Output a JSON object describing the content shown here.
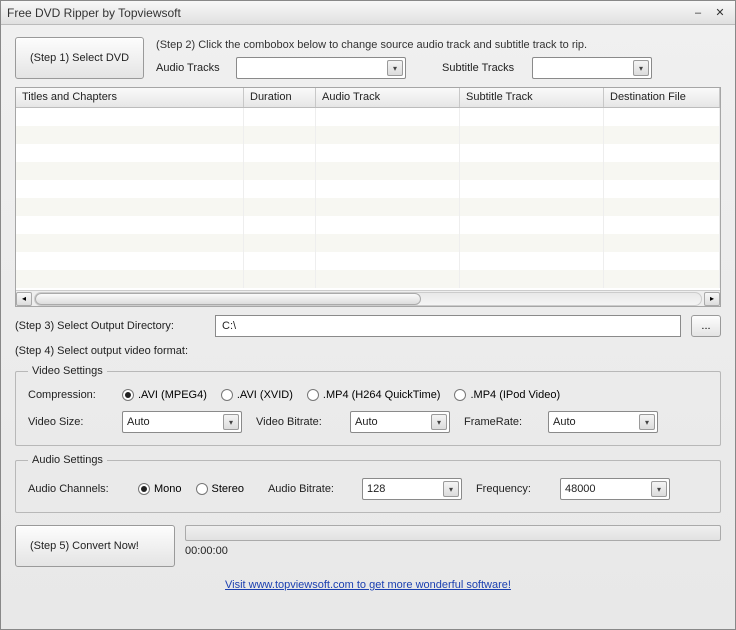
{
  "titlebar": {
    "title": "Free DVD Ripper by Topviewsoft"
  },
  "step1": {
    "button": "(Step 1) Select DVD"
  },
  "step2": {
    "instruction": "(Step 2) Click the combobox below to change source audio track and subtitle track to rip.",
    "audio_label": "Audio Tracks",
    "audio_value": "",
    "subtitle_label": "Subtitle Tracks",
    "subtitle_value": ""
  },
  "grid": {
    "headers": [
      "Titles and Chapters",
      "Duration",
      "Audio Track",
      "Subtitle Track",
      "Destination File"
    ]
  },
  "step3": {
    "label": "(Step 3) Select Output Directory:",
    "value": "C:\\",
    "browse": "..."
  },
  "step4": {
    "label": "(Step 4) Select output video format:"
  },
  "video": {
    "legend": "Video Settings",
    "compression_label": "Compression:",
    "options": [
      ".AVI (MPEG4)",
      ".AVI (XVID)",
      ".MP4 (H264 QuickTime)",
      ".MP4 (IPod Video)"
    ],
    "size_label": "Video Size:",
    "size_value": "Auto",
    "bitrate_label": "Video Bitrate:",
    "bitrate_value": "Auto",
    "framerate_label": "FrameRate:",
    "framerate_value": "Auto"
  },
  "audio": {
    "legend": "Audio Settings",
    "channels_label": "Audio Channels:",
    "mono": "Mono",
    "stereo": "Stereo",
    "bitrate_label": "Audio Bitrate:",
    "bitrate_value": "128",
    "frequency_label": "Frequency:",
    "frequency_value": "48000"
  },
  "step5": {
    "button": "(Step 5) Convert Now!"
  },
  "progress": {
    "time": "00:00:00"
  },
  "footer": {
    "link": "Visit www.topviewsoft.com to get more wonderful software!"
  }
}
